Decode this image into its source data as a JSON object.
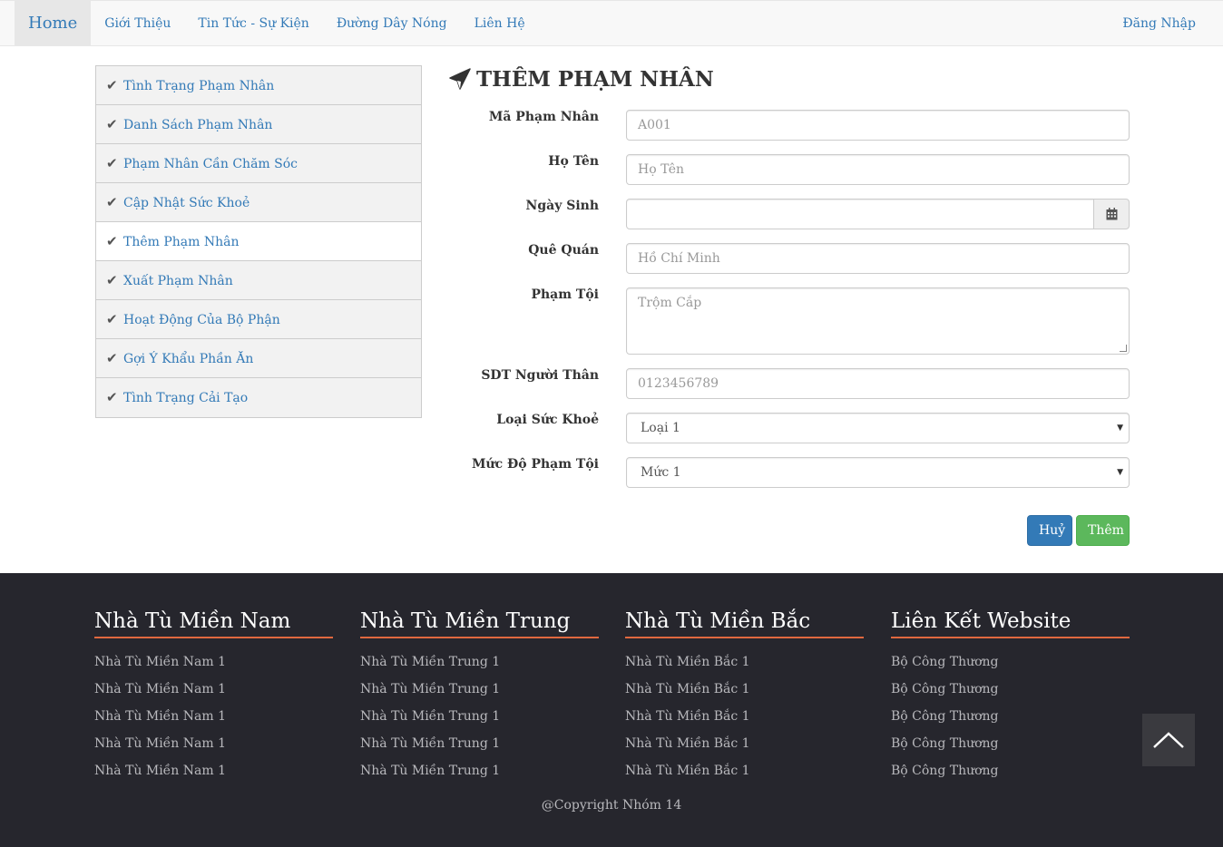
{
  "navbar": {
    "brand": "Home",
    "items": [
      "Giới Thiệu",
      "Tin Tức - Sự Kiện",
      "Đường Dây Nóng",
      "Liên Hệ"
    ],
    "login": "Đăng Nhập"
  },
  "sidebar": {
    "items": [
      {
        "label": "Tình Trạng Phạm Nhân"
      },
      {
        "label": "Danh Sách Phạm Nhân"
      },
      {
        "label": "Phạm Nhân Cần Chăm Sóc"
      },
      {
        "label": "Cập Nhật Sức Khoẻ"
      },
      {
        "label": "Thêm Phạm Nhân",
        "active": true
      },
      {
        "label": "Xuất Phạm Nhân"
      },
      {
        "label": "Hoạt Động Của Bộ Phận"
      },
      {
        "label": "Gợi Ý Khẩu Phần Ăn"
      },
      {
        "label": "Tình Trạng Cải Tạo"
      }
    ]
  },
  "form": {
    "title": "THÊM PHẠM NHÂN",
    "fields": {
      "ma": {
        "label": "Mã Phạm Nhân",
        "placeholder": "A001"
      },
      "hoten": {
        "label": "Họ Tên",
        "placeholder": "Họ Tên"
      },
      "ngaysinh": {
        "label": "Ngày Sinh",
        "value": ""
      },
      "quequan": {
        "label": "Quê Quán",
        "placeholder": "Hồ Chí Minh"
      },
      "phamtoi": {
        "label": "Phạm Tội",
        "placeholder": "Trộm Cắp"
      },
      "sdt": {
        "label": "SDT Người Thân",
        "placeholder": "0123456789"
      },
      "suckhoe": {
        "label": "Loại Sức Khoẻ",
        "value": "Loại 1"
      },
      "mucdo": {
        "label": "Mức Độ Phạm Tội",
        "value": "Mức 1"
      }
    },
    "cancel_label": "Huỷ",
    "submit_label": "Thêm"
  },
  "footer": {
    "columns": [
      {
        "title": "Nhà Tù Miền Nam",
        "links": [
          "Nhà Tù Miền Nam 1",
          "Nhà Tù Miền Nam 1",
          "Nhà Tù Miền Nam 1",
          "Nhà Tù Miền Nam 1",
          "Nhà Tù Miền Nam 1"
        ]
      },
      {
        "title": "Nhà Tù Miền Trung",
        "links": [
          "Nhà Tù Miền Trung 1",
          "Nhà Tù Miền Trung 1",
          "Nhà Tù Miền Trung 1",
          "Nhà Tù Miền Trung 1",
          "Nhà Tù Miền Trung 1"
        ]
      },
      {
        "title": "Nhà Tù Miền Bắc",
        "links": [
          "Nhà Tù Miền Bắc 1",
          "Nhà Tù Miền Bắc 1",
          "Nhà Tù Miền Bắc 1",
          "Nhà Tù Miền Bắc 1",
          "Nhà Tù Miền Bắc 1"
        ]
      },
      {
        "title": "Liên Kết Website",
        "links": [
          "Bộ Công Thương",
          "Bộ Công Thương",
          "Bộ Công Thương",
          "Bộ Công Thương",
          "Bộ Công Thương"
        ]
      }
    ],
    "copyright": "@Copyright Nhóm 14"
  },
  "colors": {
    "link": "#337ab7",
    "footer_bg": "#26262d",
    "footer_accent": "#e0683f",
    "primary": "#337ab7",
    "success": "#5cb85c"
  },
  "icons": {
    "check": "check-icon",
    "title": "paper-plane-icon",
    "calendar": "calendar-icon",
    "to_top": "chevron-up-icon"
  }
}
